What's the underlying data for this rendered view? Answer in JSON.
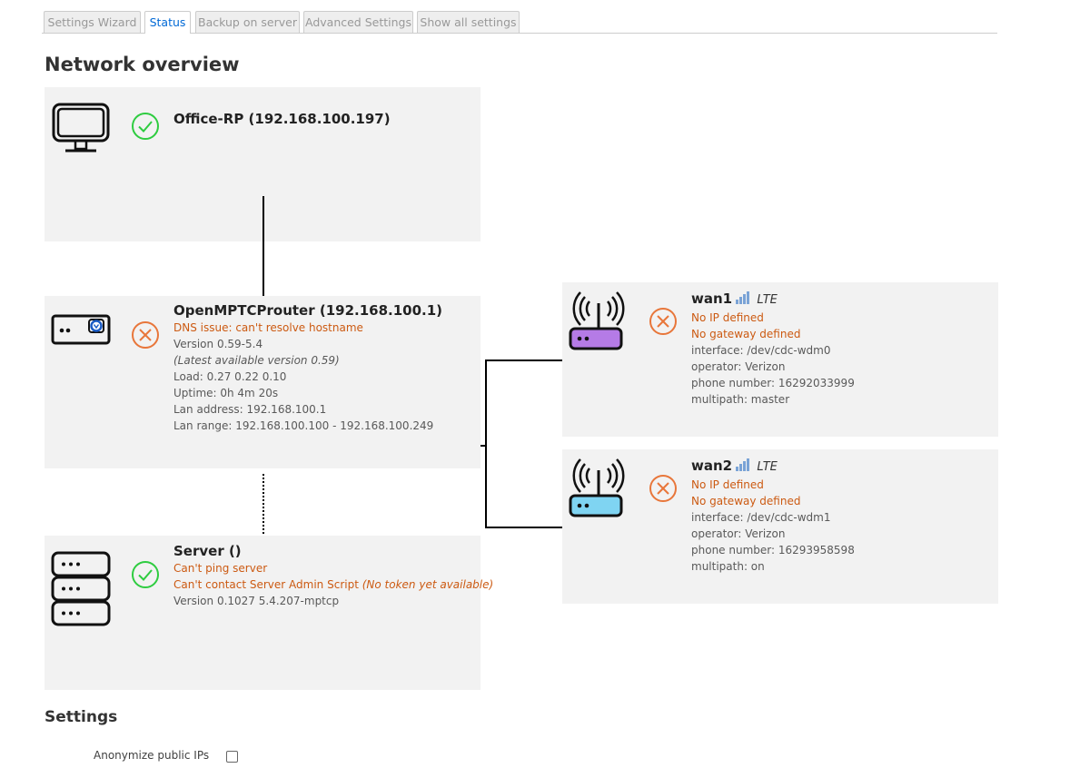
{
  "tabs": [
    {
      "label": "Settings Wizard"
    },
    {
      "label": "Status"
    },
    {
      "label": "Backup on server"
    },
    {
      "label": "Advanced Settings"
    },
    {
      "label": "Show all settings"
    }
  ],
  "active_tab": "Status",
  "page_title": "Network overview",
  "client": {
    "name": "Office-RP (192.168.100.197)",
    "icon": "monitor-icon",
    "status_icon": "check-circle-icon"
  },
  "router": {
    "name": "OpenMPTCProuter (192.168.100.1)",
    "error": "DNS issue: can't resolve hostname",
    "version": "Version 0.59-5.4",
    "latest": "(Latest available version 0.59)",
    "load": "Load: 0.27 0.22 0.10",
    "uptime": "Uptime: 0h 4m 20s",
    "lan_address": "Lan address: 192.168.100.1",
    "lan_range": "Lan range: 192.168.100.100 - 192.168.100.249",
    "icon": "router-icon",
    "status_icon": "x-circle-icon"
  },
  "server": {
    "name": "Server ()",
    "error_ping": "Can't ping server",
    "error_admin": "Can't contact Server Admin Script",
    "error_admin_note": "(No token yet available)",
    "version": "Version 0.1027 5.4.207-mptcp",
    "icon": "server-icon",
    "status_icon": "check-circle-icon"
  },
  "wans": [
    {
      "name": "wan1",
      "type": "LTE",
      "err_ip": "No IP defined",
      "err_gw": "No gateway defined",
      "interface": "interface: /dev/cdc-wdm0",
      "operator": "operator: Verizon",
      "phone": "phone number: 16292033999",
      "multipath": "multipath: master",
      "color": "#b57be6"
    },
    {
      "name": "wan2",
      "type": "LTE",
      "err_ip": "No IP defined",
      "err_gw": "No gateway defined",
      "interface": "interface: /dev/cdc-wdm1",
      "operator": "operator: Verizon",
      "phone": "phone number: 16293958598",
      "multipath": "multipath: on",
      "color": "#7fd4f2"
    }
  ],
  "colors": {
    "ok": "#2ecc40",
    "error": "#e8763a",
    "error_text": "#cc5a12",
    "panel_bg": "#f2f2f2",
    "tab_active": "#0069d6"
  },
  "settings": {
    "title": "Settings",
    "anonymize_label": "Anonymize public IPs",
    "anonymize_checked": false
  }
}
